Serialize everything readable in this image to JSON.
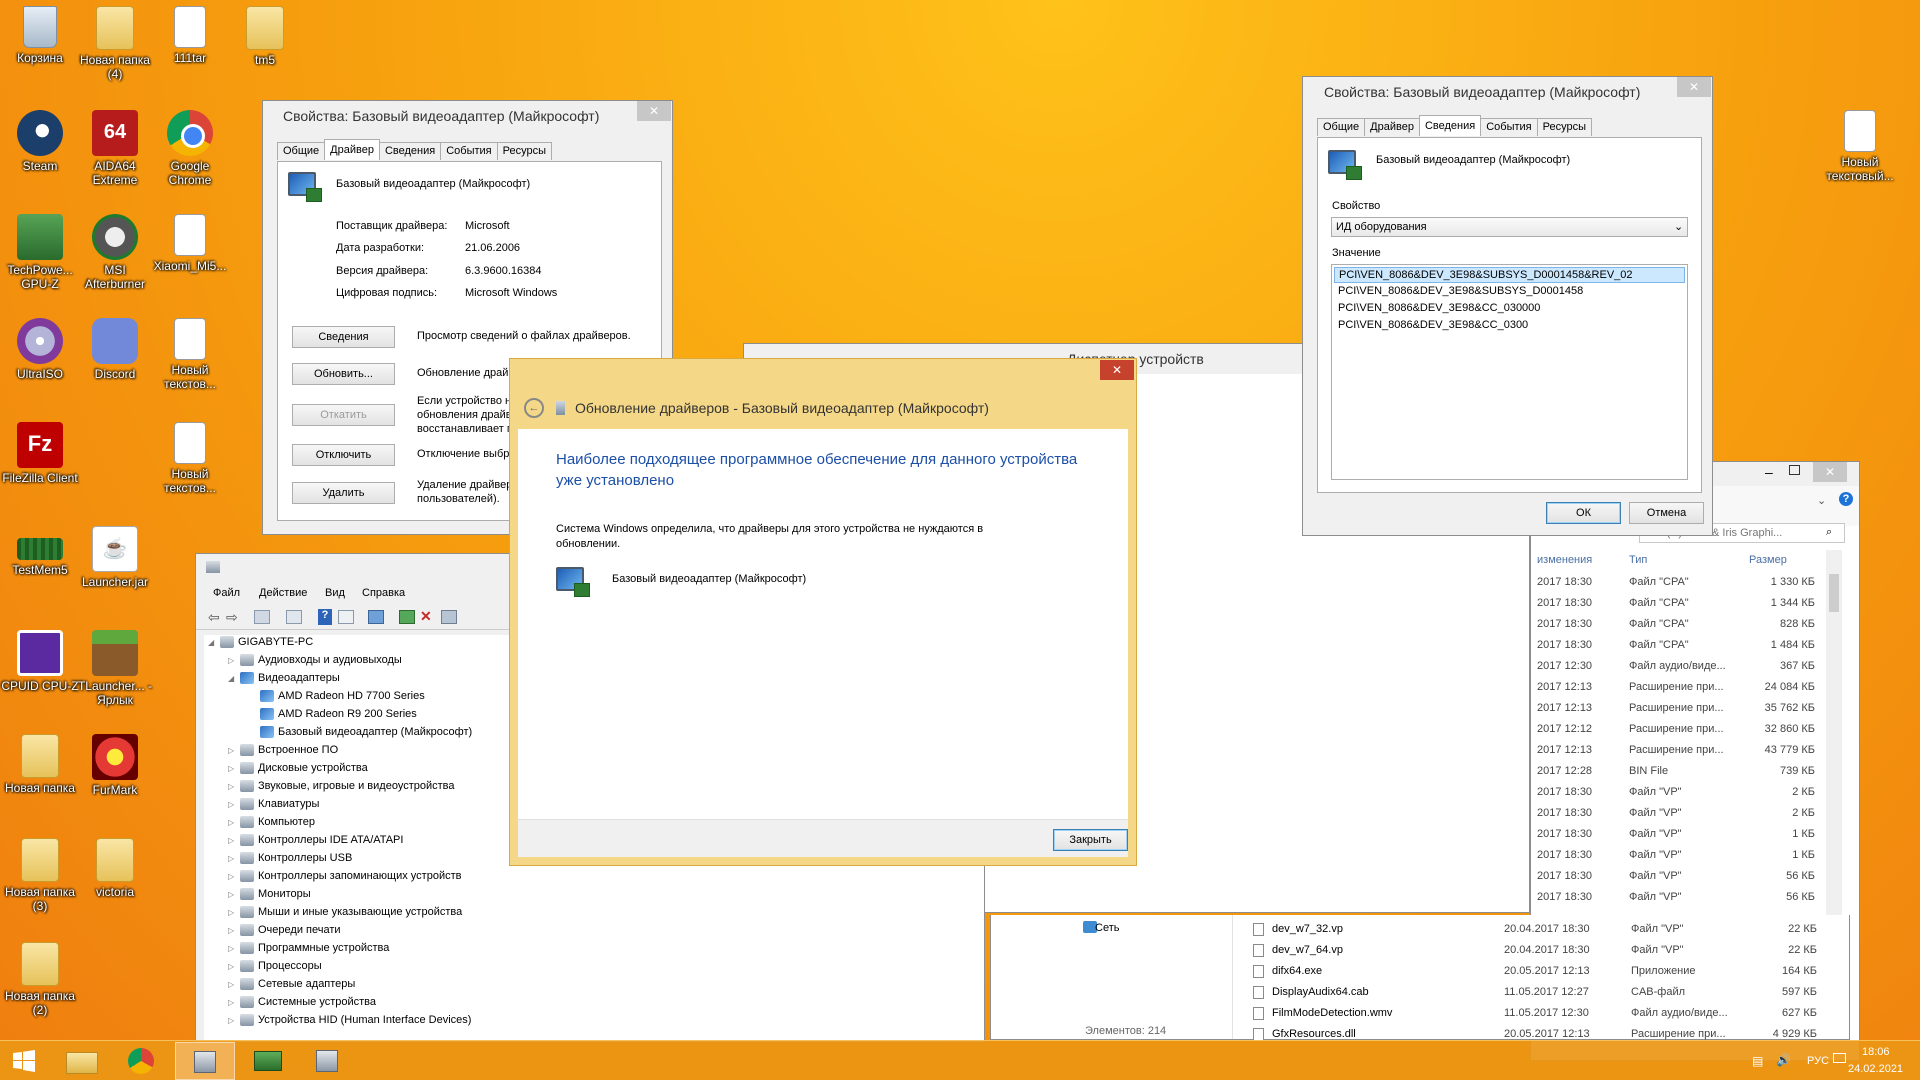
{
  "desktop_icons": [
    {
      "label": "Корзина",
      "icon": "recycle-bin-icon"
    },
    {
      "label": "Новая папка (4)",
      "icon": "folder-icon"
    },
    {
      "label": "111tar",
      "icon": "file-icon"
    },
    {
      "label": "tm5",
      "icon": "folder-icon"
    },
    {
      "label": "Steam",
      "icon": "steam-icon"
    },
    {
      "label": "AIDA64 Extreme",
      "icon": "aida64-icon"
    },
    {
      "label": "Google Chrome",
      "icon": "chrome-icon"
    },
    {
      "label": "TechPowe... GPU-Z",
      "icon": "gpuz-icon"
    },
    {
      "label": "MSI Afterburner",
      "icon": "msi-afterburner-icon"
    },
    {
      "label": "Xiaomi_Mi5...",
      "icon": "file-icon"
    },
    {
      "label": "UltraISO",
      "icon": "ultraiso-icon"
    },
    {
      "label": "Discord",
      "icon": "discord-icon"
    },
    {
      "label": "Новый текстов...",
      "icon": "text-file-icon"
    },
    {
      "label": "FileZilla Client",
      "icon": "filezilla-icon"
    },
    {
      "label": "Новый текстов...",
      "icon": "text-file-icon"
    },
    {
      "label": "TestMem5",
      "icon": "testmem-icon"
    },
    {
      "label": "Launcher.jar",
      "icon": "java-icon"
    },
    {
      "label": "CPUID CPU-Z",
      "icon": "cpuz-icon"
    },
    {
      "label": "TLauncher... - Ярлык",
      "icon": "minecraft-icon"
    },
    {
      "label": "Новая папка",
      "icon": "folder-icon"
    },
    {
      "label": "FurMark",
      "icon": "furmark-icon"
    },
    {
      "label": "Новая папка (3)",
      "icon": "folder-icon"
    },
    {
      "label": "victoria",
      "icon": "folder-icon"
    },
    {
      "label": "Новая папка (2)",
      "icon": "folder-icon"
    },
    {
      "label": "Новый текстовый...",
      "icon": "text-file-icon"
    }
  ],
  "props_driver": {
    "title": "Свойства: Базовый видеоадаптер (Майкрософт)",
    "tabs": [
      "Общие",
      "Драйвер",
      "Сведения",
      "События",
      "Ресурсы"
    ],
    "device_name": "Базовый видеоадаптер (Майкрософт)",
    "fields": [
      {
        "label": "Поставщик драйвера:",
        "value": "Microsoft"
      },
      {
        "label": "Дата разработки:",
        "value": "21.06.2006"
      },
      {
        "label": "Версия драйвера:",
        "value": "6.3.9600.16384"
      },
      {
        "label": "Цифровая подпись:",
        "value": "Microsoft Windows"
      }
    ],
    "buttons": [
      {
        "label": "Сведения",
        "desc": "Просмотр сведений о файлах драйверов."
      },
      {
        "label": "Обновить...",
        "desc": "Обновление драйв"
      },
      {
        "label": "Откатить",
        "desc": "Если устройство н обновления драйв восстанавливает п"
      },
      {
        "label": "Отключить",
        "desc": "Отключение выбра"
      },
      {
        "label": "Удалить",
        "desc": "Удаление драйвер пользователей)."
      }
    ]
  },
  "props_details": {
    "title": "Свойства: Базовый видеоадаптер (Майкрософт)",
    "tabs": [
      "Общие",
      "Драйвер",
      "Сведения",
      "События",
      "Ресурсы"
    ],
    "device_name": "Базовый видеоадаптер (Майкрософт)",
    "property_label": "Свойство",
    "property_value": "ИД оборудования",
    "value_label": "Значение",
    "values": [
      "PCI\\VEN_8086&DEV_3E98&SUBSYS_D0001458&REV_02",
      "PCI\\VEN_8086&DEV_3E98&SUBSYS_D0001458",
      "PCI\\VEN_8086&DEV_3E98&CC_030000",
      "PCI\\VEN_8086&DEV_3E98&CC_0300"
    ],
    "ok": "ОК",
    "cancel": "Отмена"
  },
  "device_manager": {
    "title": "Диспетчер устройств",
    "menu": [
      "Файл",
      "Действие",
      "Вид",
      "Справка"
    ],
    "root": "GIGABYTE-PC",
    "tree": [
      {
        "label": "Аудиовходы и аудиовыходы",
        "level": 1,
        "expanded": false
      },
      {
        "label": "Видеоадаптеры",
        "level": 1,
        "expanded": true
      },
      {
        "label": "AMD Radeon HD 7700 Series",
        "level": 2
      },
      {
        "label": "AMD Radeon R9 200 Series",
        "level": 2
      },
      {
        "label": "Базовый видеоадаптер (Майкрософт)",
        "level": 2
      },
      {
        "label": "Встроенное ПО",
        "level": 1,
        "expanded": false
      },
      {
        "label": "Дисковые устройства",
        "level": 1,
        "expanded": false
      },
      {
        "label": "Звуковые, игровые и видеоустройства",
        "level": 1,
        "expanded": false
      },
      {
        "label": "Клавиатуры",
        "level": 1,
        "expanded": false
      },
      {
        "label": "Компьютер",
        "level": 1,
        "expanded": false
      },
      {
        "label": "Контроллеры IDE ATA/ATAPI",
        "level": 1,
        "expanded": false
      },
      {
        "label": "Контроллеры USB",
        "level": 1,
        "expanded": false
      },
      {
        "label": "Контроллеры запоминающих устройств",
        "level": 1,
        "expanded": false
      },
      {
        "label": "Мониторы",
        "level": 1,
        "expanded": false
      },
      {
        "label": "Мыши и иные указывающие устройства",
        "level": 1,
        "expanded": false
      },
      {
        "label": "Очереди печати",
        "level": 1,
        "expanded": false
      },
      {
        "label": "Программные устройства",
        "level": 1,
        "expanded": false
      },
      {
        "label": "Процессоры",
        "level": 1,
        "expanded": false
      },
      {
        "label": "Сетевые адаптеры",
        "level": 1,
        "expanded": false
      },
      {
        "label": "Системные устройства",
        "level": 1,
        "expanded": false
      },
      {
        "label": "Устройства HID (Human Interface Devices)",
        "level": 1,
        "expanded": false
      }
    ]
  },
  "update_dialog": {
    "title": "Обновление драйверов - Базовый видеоадаптер (Майкрософт)",
    "heading": "Наиболее подходящее программное обеспечение для данного устройства уже установлено",
    "message": "Система Windows определила, что драйверы для этого устройства не нуждаются в обновлении.",
    "device_name": "Базовый видеоадаптер (Майкрософт)",
    "close": "Закрыть"
  },
  "explorer": {
    "search_placeholder": "Intel(R) UHD & Iris Graphi...",
    "columns": {
      "modified": "изменения",
      "type": "Тип",
      "size": "Размер"
    },
    "rows": [
      {
        "date": "2017 18:30",
        "type": "Файл \"CPA\"",
        "size": "1 330 КБ"
      },
      {
        "date": "2017 18:30",
        "type": "Файл \"CPA\"",
        "size": "1 344 КБ"
      },
      {
        "date": "2017 18:30",
        "type": "Файл \"CPA\"",
        "size": "828 КБ"
      },
      {
        "date": "2017 18:30",
        "type": "Файл \"CPA\"",
        "size": "1 484 КБ"
      },
      {
        "date": "2017 12:30",
        "type": "Файл аудио/виде...",
        "size": "367 КБ"
      },
      {
        "date": "2017 12:13",
        "type": "Расширение при...",
        "size": "24 084 КБ"
      },
      {
        "date": "2017 12:13",
        "type": "Расширение при...",
        "size": "35 762 КБ"
      },
      {
        "date": "2017 12:12",
        "type": "Расширение при...",
        "size": "32 860 КБ"
      },
      {
        "date": "2017 12:13",
        "type": "Расширение при...",
        "size": "43 779 КБ"
      },
      {
        "date": "2017 12:28",
        "type": "BIN File",
        "size": "739 КБ"
      },
      {
        "date": "2017 18:30",
        "type": "Файл \"VP\"",
        "size": "2 КБ"
      },
      {
        "date": "2017 18:30",
        "type": "Файл \"VP\"",
        "size": "2 КБ"
      },
      {
        "date": "2017 18:30",
        "type": "Файл \"VP\"",
        "size": "1 КБ"
      },
      {
        "date": "2017 18:30",
        "type": "Файл \"VP\"",
        "size": "1 КБ"
      },
      {
        "date": "2017 18:30",
        "type": "Файл \"VP\"",
        "size": "56 КБ"
      },
      {
        "date": "2017 18:30",
        "type": "Файл \"VP\"",
        "size": "56 КБ"
      }
    ],
    "nav_network": "Сеть",
    "full_rows": [
      {
        "name": "dev_w7_32.vp",
        "date": "20.04.2017 18:30",
        "type": "Файл \"VP\"",
        "size": "22 КБ"
      },
      {
        "name": "dev_w7_64.vp",
        "date": "20.04.2017 18:30",
        "type": "Файл \"VP\"",
        "size": "22 КБ"
      },
      {
        "name": "difx64.exe",
        "date": "20.05.2017 12:13",
        "type": "Приложение",
        "size": "164 КБ"
      },
      {
        "name": "DisplayAudix64.cab",
        "date": "11.05.2017 12:27",
        "type": "CAB-файл",
        "size": "597 КБ"
      },
      {
        "name": "FilmModeDetection.wmv",
        "date": "11.05.2017 12:30",
        "type": "Файл аудио/виде...",
        "size": "627 КБ"
      },
      {
        "name": "GfxResources.dll",
        "date": "20.05.2017 12:13",
        "type": "Расширение при...",
        "size": "4 929 КБ"
      }
    ],
    "status": "Элементов: 214"
  },
  "taskbar": {
    "lang": "РУС",
    "time": "18:06",
    "date": "24.02.2021"
  },
  "colors": {
    "accent_blue": "#1c4fa7",
    "close_red": "#c7422c",
    "dialog_frame": "#f5d887"
  }
}
